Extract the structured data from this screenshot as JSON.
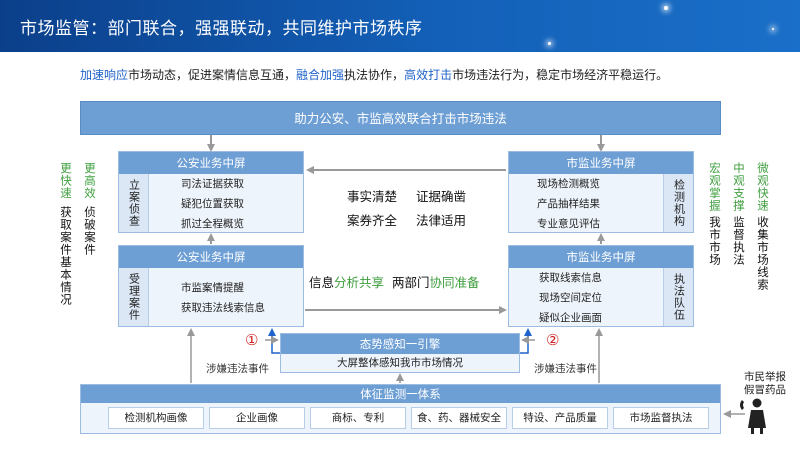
{
  "header": {
    "title": "市场监管：部门联合，强强联动，共同维护市场秩序"
  },
  "intro": {
    "hl1": "加速响应",
    "t1": "市场动态，促进案情信息互通，",
    "hl2": "融合加强",
    "t2": "执法协作，",
    "hl3": "高效打击",
    "t3": "市场违法行为，稳定市场经济平稳运行。"
  },
  "banner": {
    "text": "助力公安、市监高效联合打击市场违法"
  },
  "left_side": {
    "col1_green": "更快速",
    "col1_black": "获取案件基本情况",
    "col2_green": "更高效",
    "col2_black": "侦破案件"
  },
  "right_side": {
    "col1_green": "宏观掌握",
    "col1_black": "我市市场",
    "col2_green": "中观支撑",
    "col2_black": "监督执法",
    "col3_green": "微观快速",
    "col3_black": "收集市场线索"
  },
  "police_top": {
    "title": "公安业务中屏",
    "side": "立案侦查",
    "lines": [
      "司法证据获取",
      "疑犯位置获取",
      "抓过全程概览"
    ]
  },
  "police_bottom": {
    "title": "公安业务中屏",
    "side": "受理案件",
    "lines": [
      "市监案情提醒",
      "获取违法线索信息"
    ]
  },
  "market_top": {
    "title": "市监业务中屏",
    "side": "检测机构",
    "lines": [
      "现场检测概览",
      "产品抽样结果",
      "专业意见评估"
    ]
  },
  "market_bottom": {
    "title": "市监业务中屏",
    "side": "执法队伍",
    "lines": [
      "获取线索信息",
      "现场空间定位",
      "疑似企业画面"
    ]
  },
  "center": {
    "r1a": "事实清楚",
    "r1b": "证据确凿",
    "r2a": "案券齐全",
    "r2b": "法律适用",
    "r3_pre": "信息",
    "r3_g": "分析共享",
    "r3_mid": "两部门",
    "r3_g2": "协同准备"
  },
  "engine": {
    "title": "态势感知一引擎",
    "sub": "大屏整体感知我市市场情况"
  },
  "markers": {
    "one": "①",
    "two": "②"
  },
  "labels": {
    "left_event": "涉嫌违法事件",
    "right_event": "涉嫌违法事件"
  },
  "system": {
    "title": "体征监测一体系",
    "chips": [
      "检测机构画像",
      "企业画像",
      "商标、专利",
      "食、药、器械安全",
      "特设、产品质量",
      "市场监督执法"
    ]
  },
  "citizen": {
    "line1": "市民举报",
    "line2": "假冒药品"
  },
  "colors": {
    "title_bar": "#1360b8",
    "panel_head": "#6e9fd4",
    "highlight_blue": "#1f63c9",
    "highlight_green": "#3f9e3f",
    "marker_red": "#d02020"
  }
}
